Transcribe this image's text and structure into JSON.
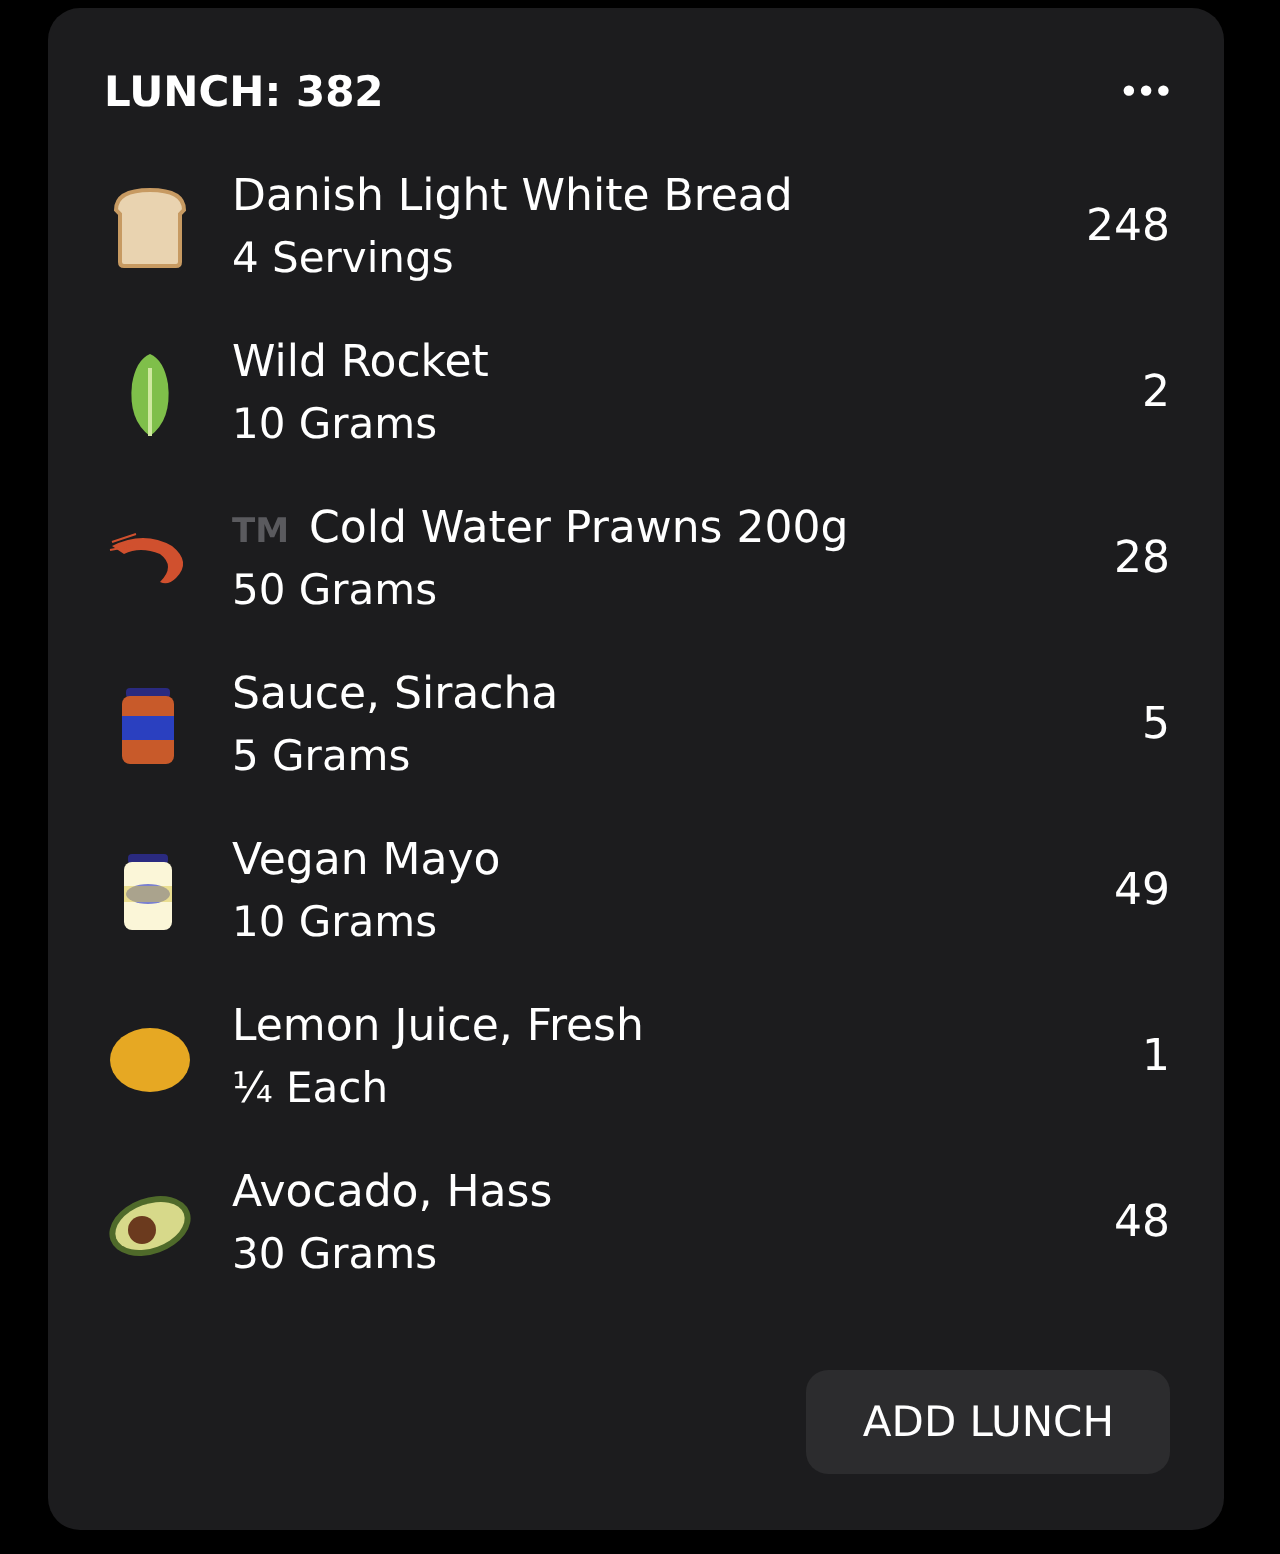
{
  "meal": {
    "title": "LUNCH: 382",
    "more": "•••"
  },
  "items": [
    {
      "kind": "bread",
      "name": "Danish Light White Bread",
      "amount": "4 Servings",
      "calories": "248"
    },
    {
      "kind": "lettuce",
      "name": "Wild Rocket",
      "amount": "10 Grams",
      "calories": "2"
    },
    {
      "kind": "shrimp",
      "prefix": "TM",
      "name": "Cold Water Prawns 200g",
      "amount": "50 Grams",
      "calories": "28"
    },
    {
      "kind": "sauce",
      "name": "Sauce, Siracha",
      "amount": "5 Grams",
      "calories": "5"
    },
    {
      "kind": "mayo",
      "name": "Vegan Mayo",
      "amount": "10 Grams",
      "calories": "49"
    },
    {
      "kind": "lemon",
      "name": "Lemon Juice, Fresh",
      "amount": "¼ Each",
      "calories": "1"
    },
    {
      "kind": "avocado",
      "name": "Avocado, Hass",
      "amount": "30 Grams",
      "calories": "48"
    }
  ],
  "add_button": "ADD LUNCH"
}
